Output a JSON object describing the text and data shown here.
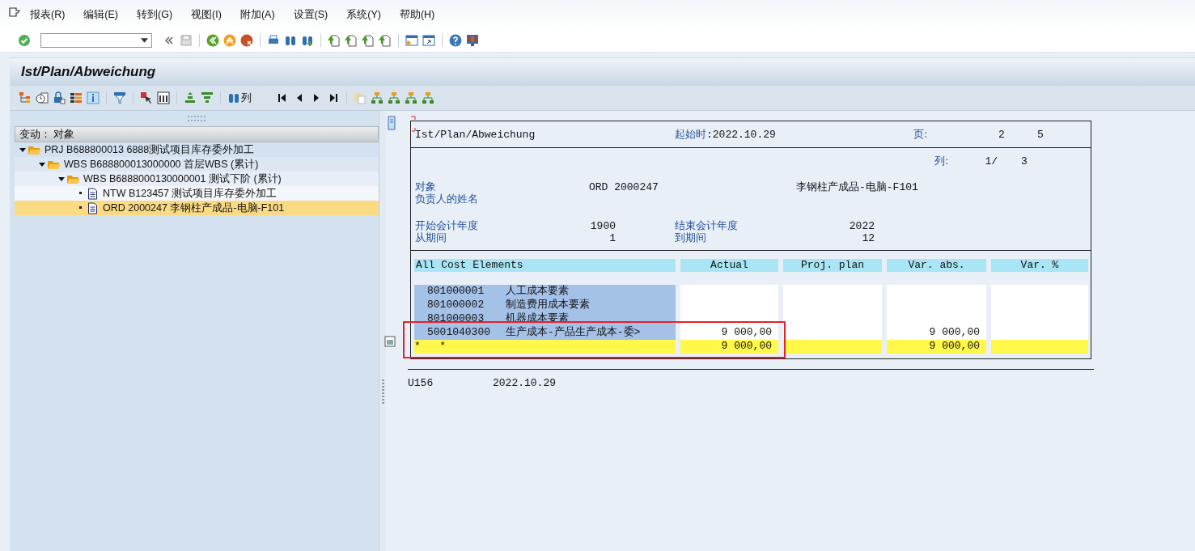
{
  "menu": {
    "items": [
      "报表(R)",
      "编辑(E)",
      "转到(G)",
      "视图(I)",
      "附加(A)",
      "设置(S)",
      "系统(Y)",
      "帮助(H)"
    ]
  },
  "title": "Ist/Plan/Abweichung",
  "app_toolbar": {
    "find_column_label": "列"
  },
  "tree": {
    "header": "变动：  对象",
    "nodes": [
      {
        "kind": "folder",
        "label": "PRJ B688800013 6888测试项目库存委外加工",
        "expanded": true,
        "selected": false,
        "children": [
          {
            "kind": "folder",
            "label": "WBS B688800013000000 首层WBS (累计)",
            "expanded": true,
            "selected": false,
            "children": [
              {
                "kind": "folder",
                "label": "WBS B6888000130000001 测试下阶 (累计)",
                "expanded": true,
                "selected": false,
                "children": [
                  {
                    "kind": "document",
                    "label": "NTW B123457 测试项目库存委外加工",
                    "selected": false
                  },
                  {
                    "kind": "document",
                    "label": "ORD 2000247 李钢柱产成品-电脑-F101",
                    "selected": true
                  }
                ]
              }
            ]
          }
        ]
      }
    ]
  },
  "report": {
    "title": "Ist/Plan/Abweichung",
    "start_label": "起始时",
    "start_value": ":2022.10.29",
    "page_label": "页:",
    "page": "2",
    "pages": "5",
    "column_label": "列:",
    "column": "1/",
    "columns_total": "3",
    "object_label": "对象",
    "object_value": "ORD 2000247",
    "object_name": "李钢柱产成品-电脑-F101",
    "responsible_label": "负责人的姓名",
    "from_year_label": "开始会计年度",
    "from_year": "1900",
    "to_year_label": "结束会计年度",
    "to_year": "2022",
    "from_period_label": "从期间",
    "from_period": "1",
    "to_period_label": "到期间",
    "to_period": "12",
    "table": {
      "columns": [
        "All Cost Elements",
        "Actual",
        "Proj. plan",
        "Var. abs.",
        "Var. %"
      ],
      "rows": [
        {
          "kind": "item",
          "code": "801000001",
          "name": "人工成本要素"
        },
        {
          "kind": "item",
          "code": "801000002",
          "name": "制造费用成本要素"
        },
        {
          "kind": "item",
          "code": "801000003",
          "name": "机器成本要素"
        },
        {
          "kind": "item",
          "code": "5001040300",
          "name": "生产成本-产品生产成本-委>",
          "actual": "9 000,00",
          "var_abs": "9 000,00"
        },
        {
          "kind": "total",
          "label": "*   *",
          "actual": "9 000,00",
          "var_abs": "9 000,00"
        }
      ]
    },
    "footer_user": "U156",
    "footer_date": "2022.10.29"
  }
}
